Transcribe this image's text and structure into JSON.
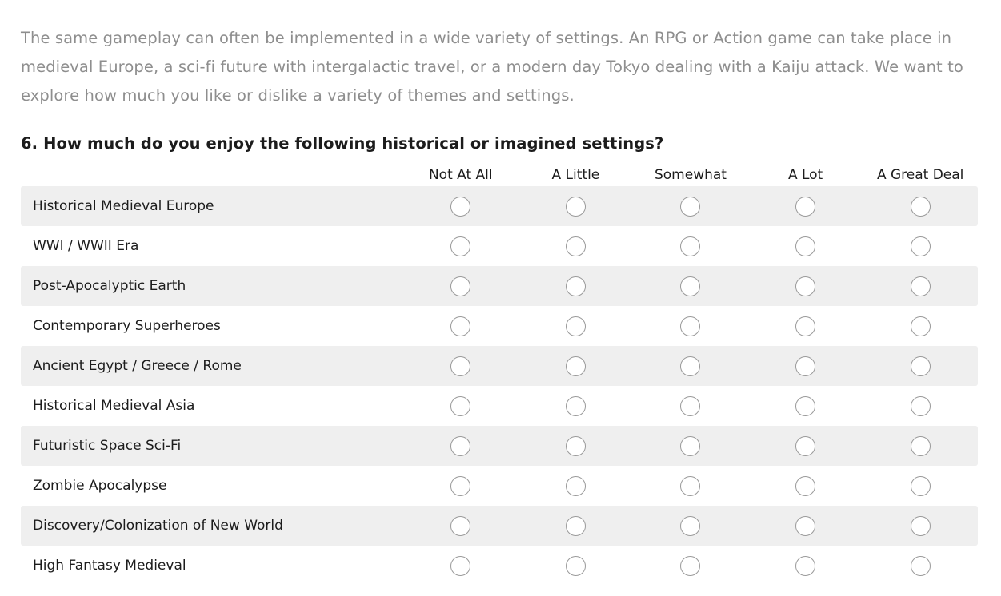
{
  "intro": {
    "paragraph": "The same gameplay can often be implemented in a wide variety of settings. An RPG or Action game can take place in medieval Europe, a sci-fi future with intergalactic travel, or a modern day Tokyo dealing with a Kaiju attack. We want to explore how much you like or dislike a variety of themes and settings."
  },
  "question": {
    "number": "6.",
    "title": "6. How much do you enjoy the following historical or imagined settings?"
  },
  "matrix": {
    "columns": [
      {
        "label": "Not At All"
      },
      {
        "label": "A Little"
      },
      {
        "label": "Somewhat"
      },
      {
        "label": "A Lot"
      },
      {
        "label": "A Great Deal"
      }
    ],
    "rows": [
      {
        "label": "Historical Medieval Europe",
        "selected": null
      },
      {
        "label": "WWI / WWII Era",
        "selected": null
      },
      {
        "label": "Post-Apocalyptic Earth",
        "selected": null
      },
      {
        "label": "Contemporary Superheroes",
        "selected": null
      },
      {
        "label": "Ancient Egypt / Greece / Rome",
        "selected": null
      },
      {
        "label": "Historical Medieval Asia",
        "selected": null
      },
      {
        "label": "Futuristic Space Sci-Fi",
        "selected": null
      },
      {
        "label": "Zombie Apocalypse",
        "selected": null
      },
      {
        "label": "Discovery/Colonization of New World",
        "selected": null
      },
      {
        "label": "High Fantasy Medieval",
        "selected": null
      }
    ]
  },
  "colors": {
    "stripe": "#efefef",
    "text_dark": "#1c1c1c",
    "text_muted": "#8e8e8e",
    "radio_border": "#9a9a9a",
    "page_background": "#ffffff"
  }
}
